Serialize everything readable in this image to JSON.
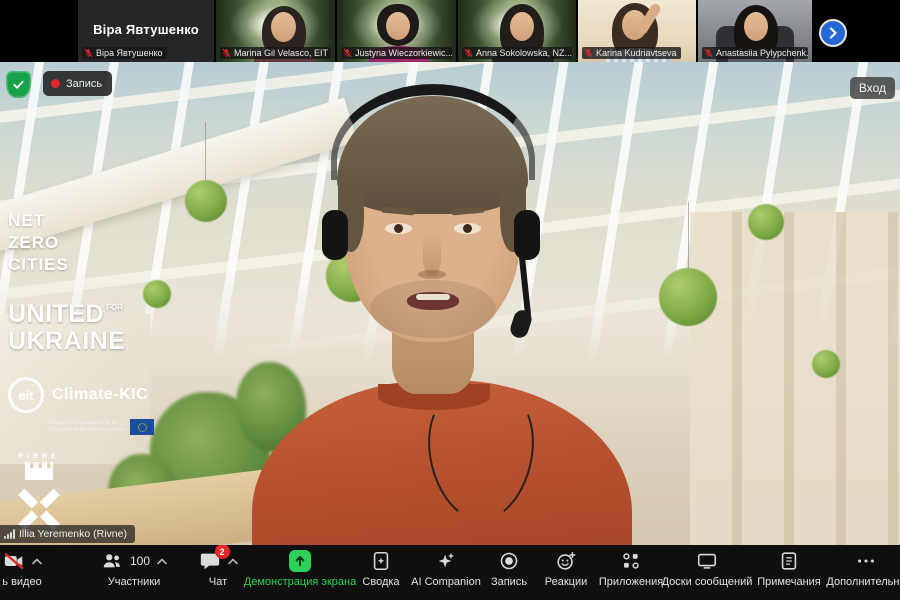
{
  "colors": {
    "accent_green": "#2ed158",
    "badge_red": "#e02828",
    "next_button_blue": "#2468d8",
    "shield_green": "#17a24a",
    "shirt_orange": "#b55030"
  },
  "topbar": {
    "recording_label": "Запись",
    "enter_button": "Вход"
  },
  "filmstrip": {
    "participants": [
      {
        "name": "Віра Явтушенко",
        "label": "Віра Явтушенко",
        "video": false,
        "muted": true
      },
      {
        "label": "Marina Gil Velasco, EIT ...",
        "video": true,
        "muted": true
      },
      {
        "label": "Justyna Wieczorkiewic...",
        "video": true,
        "muted": true
      },
      {
        "label": "Anna Sokolowska, NZ...",
        "video": true,
        "muted": true
      },
      {
        "label": "Karina Kudriavtseva",
        "video": true,
        "muted": true
      },
      {
        "label": "Anastasiia Pylypchenk...",
        "video": true,
        "muted": true
      }
    ]
  },
  "logos": {
    "net_zero": {
      "line1": "NET",
      "line2": "ZERO",
      "line3": "CITIES"
    },
    "united": {
      "word1": "UNITED",
      "for": "FOR",
      "word2": "UKRAINE"
    },
    "climate_kic": {
      "eit": "eit",
      "name": "Climate-KIC",
      "support1": "Climate-KIC is supported by the",
      "support2": "EIT, a body of the European Union"
    },
    "rivne": {
      "name": "РІВНЕ"
    }
  },
  "speaker": {
    "name_tag": "Illia Yeremenko (Rivne)"
  },
  "toolbar": {
    "video": {
      "label": "ь видео"
    },
    "participants": {
      "label": "Участники",
      "count": "100"
    },
    "chat": {
      "label": "Чат",
      "badge": "2"
    },
    "share": {
      "label": "Демонстрация экрана"
    },
    "summary": {
      "label": "Сводка"
    },
    "ai": {
      "label": "AI Companion"
    },
    "record": {
      "label": "Запись"
    },
    "reactions": {
      "label": "Реакции"
    },
    "apps": {
      "label": "Приложения"
    },
    "whiteboards": {
      "label": "Доски сообщений"
    },
    "notes": {
      "label": "Примечания"
    },
    "more": {
      "label": "Дополнительно"
    }
  }
}
